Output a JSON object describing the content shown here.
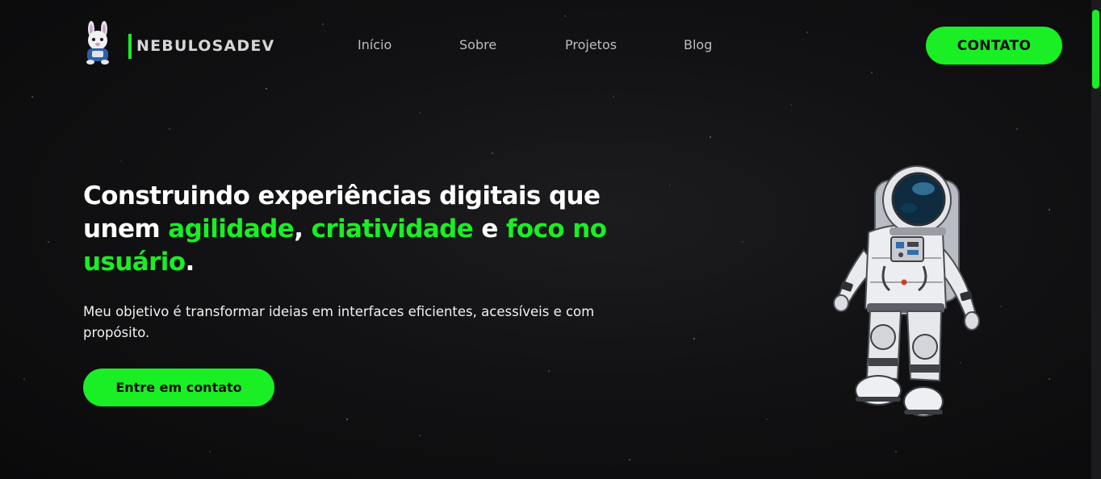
{
  "header": {
    "logo_icon": "bunny-astronaut-logo",
    "brand": "NEBULOSADEV",
    "nav": [
      "Início",
      "Sobre",
      "Projetos",
      "Blog"
    ],
    "contact_button": "CONTATO"
  },
  "hero": {
    "headline": {
      "part1": "Construindo experiências digitais que unem ",
      "highlight1": "agilidade",
      "sep1": ", ",
      "highlight2": "criatividade",
      "sep2": " e ",
      "highlight3": "foco no usuário",
      "end": "."
    },
    "subtitle": "Meu objetivo é transformar ideias em interfaces eficientes, acessíveis e com propósito.",
    "cta": "Entre em contato",
    "illustration": "astronaut-illustration"
  },
  "colors": {
    "accent": "#19ef24",
    "background": "#121214",
    "text": "#ffffff",
    "nav_text": "#bdbdbd"
  }
}
